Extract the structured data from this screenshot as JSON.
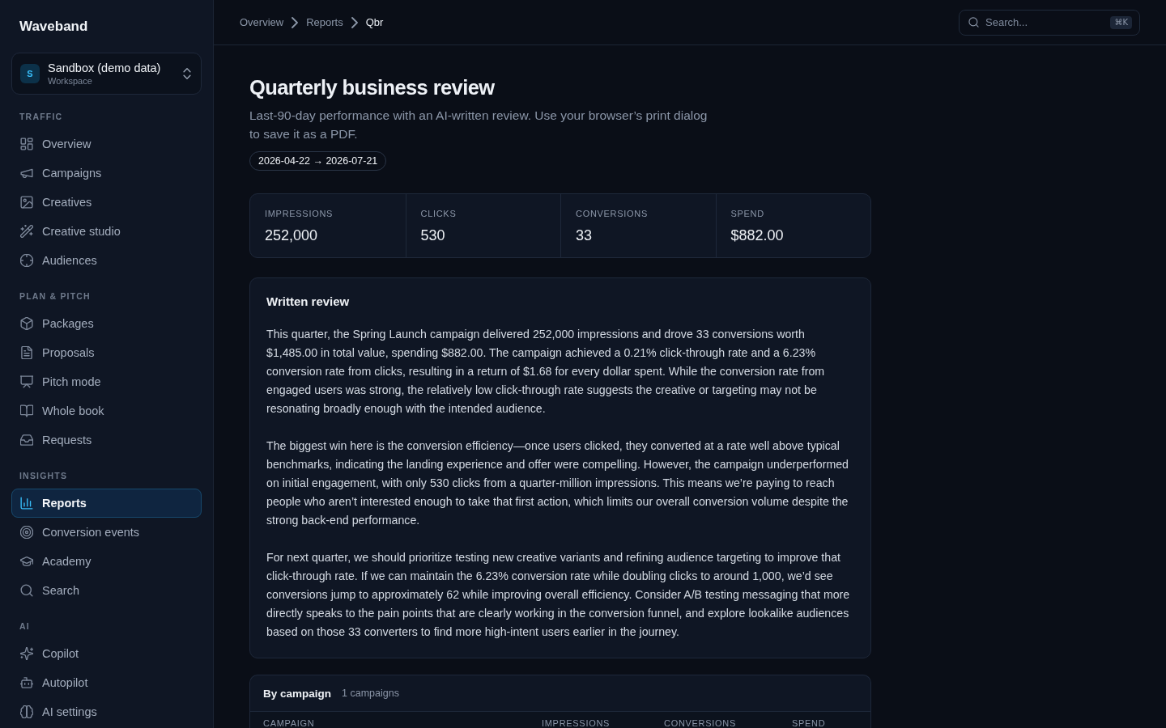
{
  "sidebar": {
    "brand": "Waveband",
    "workspace": {
      "initial": "S",
      "name": "Sandbox (demo data)",
      "label": "Workspace"
    },
    "sections": [
      {
        "title": "TRAFFIC",
        "items": [
          {
            "label": "Overview",
            "selected": false
          },
          {
            "label": "Campaigns",
            "selected": false
          },
          {
            "label": "Creatives",
            "selected": false
          },
          {
            "label": "Creative studio",
            "selected": false
          },
          {
            "label": "Audiences",
            "selected": false
          }
        ]
      },
      {
        "title": "PLAN & PITCH",
        "items": [
          {
            "label": "Packages",
            "selected": false
          },
          {
            "label": "Proposals",
            "selected": false
          },
          {
            "label": "Pitch mode",
            "selected": false
          },
          {
            "label": "Whole book",
            "selected": false
          },
          {
            "label": "Requests",
            "selected": false
          }
        ]
      },
      {
        "title": "INSIGHTS",
        "items": [
          {
            "label": "Reports",
            "selected": true
          },
          {
            "label": "Conversion events",
            "selected": false
          },
          {
            "label": "Academy",
            "selected": false
          },
          {
            "label": "Search",
            "selected": false
          }
        ]
      },
      {
        "title": "AI",
        "items": [
          {
            "label": "Copilot",
            "selected": false
          },
          {
            "label": "Autopilot",
            "selected": false
          },
          {
            "label": "AI settings",
            "selected": false
          }
        ]
      }
    ]
  },
  "breadcrumb": [
    {
      "label": "Overview",
      "current": false
    },
    {
      "label": "Reports",
      "current": false
    },
    {
      "label": "Qbr",
      "current": true
    }
  ],
  "search": {
    "placeholder": "Search...",
    "shortcut": "⌘K"
  },
  "page": {
    "title": "Quarterly business review",
    "subtitle": "Last-90-day performance with an AI-written review. Use your browser’s print dialog to save it as a PDF.",
    "date_range": "2026-04-22 → 2026-07-21"
  },
  "stats": [
    {
      "label": "IMPRESSIONS",
      "value": "252,000"
    },
    {
      "label": "CLICKS",
      "value": "530"
    },
    {
      "label": "CONVERSIONS",
      "value": "33"
    },
    {
      "label": "SPEND",
      "value": "$882.00"
    }
  ],
  "review": {
    "title": "Written review",
    "paragraphs": [
      "This quarter, the Spring Launch campaign delivered 252,000 impressions and drove 33 conversions worth $1,485.00 in total value, spending $882.00. The campaign achieved a 0.21% click-through rate and a 6.23% conversion rate from clicks, resulting in a return of $1.68 for every dollar spent. While the conversion rate from engaged users was strong, the relatively low click-through rate suggests the creative or targeting may not be resonating broadly enough with the intended audience.",
      "The biggest win here is the conversion efficiency—once users clicked, they converted at a rate well above typical benchmarks, indicating the landing experience and offer were compelling. However, the campaign underperformed on initial engagement, with only 530 clicks from a quarter-million impressions. This means we’re paying to reach people who aren’t interested enough to take that first action, which limits our overall conversion volume despite the strong back-end performance.",
      "For next quarter, we should prioritize testing new creative variants and refining audience targeting to improve that click-through rate. If we can maintain the 6.23% conversion rate while doubling clicks to around 1,000, we’d see conversions jump to approximately 62 while improving overall efficiency. Consider A/B testing messaging that more directly speaks to the pain points that are clearly working in the conversion funnel, and explore lookalike audiences based on those 33 converters to find more high-intent users earlier in the journey."
    ]
  },
  "campaign_table": {
    "title": "By campaign",
    "count": "1 campaigns",
    "columns": [
      "CAMPAIGN",
      "IMPRESSIONS",
      "CONVERSIONS",
      "SPEND"
    ]
  }
}
